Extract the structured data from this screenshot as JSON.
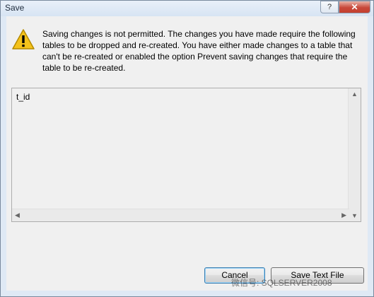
{
  "window": {
    "title": "Save",
    "help_label": "?",
    "close_label": "✕"
  },
  "message": "Saving changes is not permitted. The changes you have made require the following tables to be dropped and re-created. You have either made changes to a table that can't be re-created or enabled the option Prevent saving changes that require the table to be re-created.",
  "details": {
    "content": "t_id"
  },
  "buttons": {
    "cancel": "Cancel",
    "save_text_file": "Save Text File"
  },
  "watermark": "微信号: SQLSERVER2008"
}
